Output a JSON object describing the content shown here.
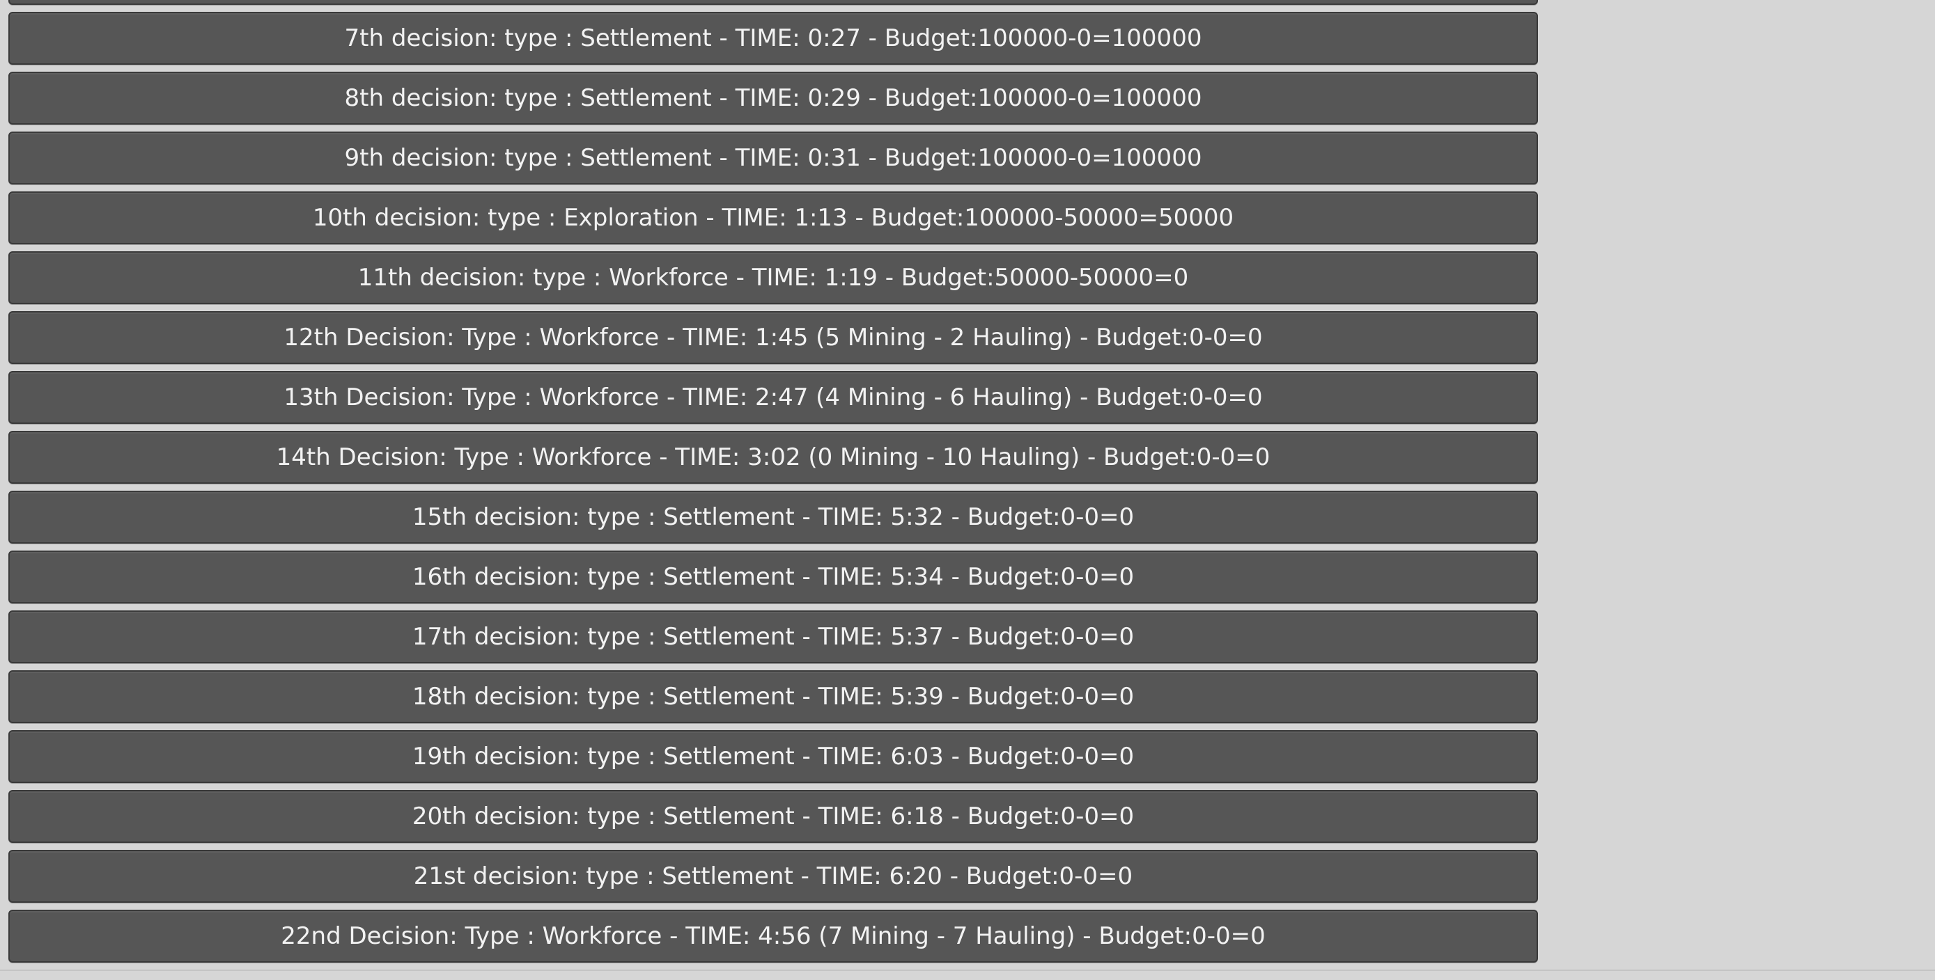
{
  "decisions": [
    {
      "label": ""
    },
    {
      "label": "7th decision: type : Settlement - TIME: 0:27 - Budget:100000-0=100000"
    },
    {
      "label": "8th decision: type : Settlement - TIME: 0:29 - Budget:100000-0=100000"
    },
    {
      "label": "9th decision: type : Settlement - TIME: 0:31 - Budget:100000-0=100000"
    },
    {
      "label": "10th decision: type : Exploration - TIME: 1:13 - Budget:100000-50000=50000"
    },
    {
      "label": "11th decision: type : Workforce - TIME: 1:19 - Budget:50000-50000=0"
    },
    {
      "label": "12th Decision: Type : Workforce - TIME: 1:45 (5 Mining - 2 Hauling) - Budget:0-0=0"
    },
    {
      "label": "13th Decision: Type : Workforce - TIME: 2:47 (4 Mining - 6 Hauling) - Budget:0-0=0"
    },
    {
      "label": "14th Decision: Type : Workforce - TIME: 3:02 (0 Mining - 10 Hauling) - Budget:0-0=0"
    },
    {
      "label": "15th decision: type : Settlement - TIME: 5:32 - Budget:0-0=0"
    },
    {
      "label": "16th decision: type : Settlement - TIME: 5:34 - Budget:0-0=0"
    },
    {
      "label": "17th decision: type : Settlement - TIME: 5:37 - Budget:0-0=0"
    },
    {
      "label": "18th decision: type : Settlement - TIME: 5:39 - Budget:0-0=0"
    },
    {
      "label": "19th decision: type : Settlement - TIME: 6:03 - Budget:0-0=0"
    },
    {
      "label": "20th decision: type : Settlement - TIME: 6:18 - Budget:0-0=0"
    },
    {
      "label": "21st decision: type : Settlement - TIME: 6:20 - Budget:0-0=0"
    },
    {
      "label": "22nd Decision: Type : Workforce - TIME: 4:56 (7 Mining - 7 Hauling) - Budget:0-0=0"
    }
  ]
}
